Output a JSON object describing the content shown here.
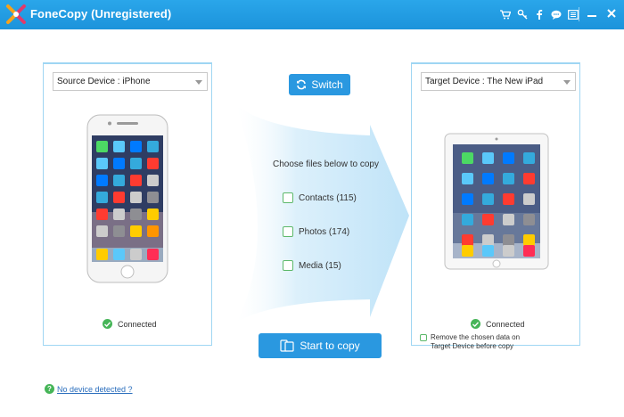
{
  "window": {
    "title": "FoneCopy (Unregistered)",
    "toolbar_icons": [
      "cart-icon",
      "key-icon",
      "facebook-icon",
      "chat-icon",
      "menu-icon"
    ],
    "controls": [
      "minimize-icon",
      "close-icon"
    ]
  },
  "source": {
    "dropdown_label": "Source Device : iPhone",
    "status": "Connected"
  },
  "target": {
    "dropdown_label": "Target Device : The New iPad",
    "status": "Connected",
    "remove_option": "Remove the chosen data on Target Device before copy"
  },
  "center": {
    "switch_label": "Switch",
    "choose_label": "Choose files below to copy",
    "options": [
      {
        "label": "Contacts (115)",
        "checked": false
      },
      {
        "label": "Photos (174)",
        "checked": false
      },
      {
        "label": "Media (15)",
        "checked": false
      }
    ],
    "start_label": "Start to copy"
  },
  "footer": {
    "help_link": "No device detected ?"
  },
  "colors": {
    "titlebar": "#1f98e0",
    "button": "#2a98e0",
    "panel_border": "#9fd6f3",
    "success": "#46b558",
    "link": "#2a6ebd"
  }
}
